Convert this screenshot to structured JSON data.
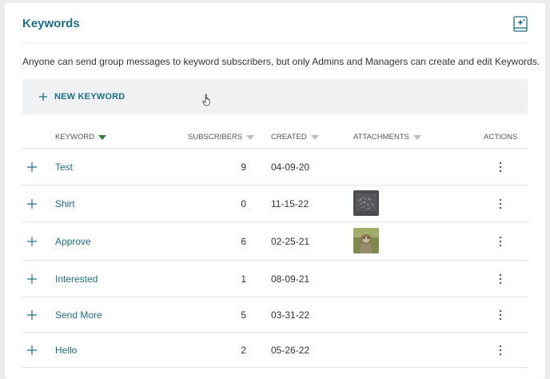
{
  "header": {
    "title": "Keywords",
    "icon": "sparkle-document-icon"
  },
  "description": "Anyone can send group messages to keyword subscribers, but only Admins and Managers can create and edit Keywords.",
  "new_keyword": {
    "label": "NEW KEYWORD",
    "icon": "plus-icon"
  },
  "table": {
    "columns": {
      "keyword": "KEYWORD",
      "subscribers": "SUBSCRIBERS",
      "created": "CREATED",
      "attachments": "ATTACHMENTS",
      "actions": "ACTIONS"
    },
    "sort": {
      "column": "keyword",
      "active_color": "#2e7d32"
    },
    "rows": [
      {
        "keyword": "Test",
        "subscribers": "9",
        "created": "04-09-20",
        "attachment": ""
      },
      {
        "keyword": "Shirt",
        "subscribers": "0",
        "created": "11-15-22",
        "attachment": "dark-image-thumbnail"
      },
      {
        "keyword": "Approve",
        "subscribers": "6",
        "created": "02-25-21",
        "attachment": "photo-thumbnail"
      },
      {
        "keyword": "Interested",
        "subscribers": "1",
        "created": "08-09-21",
        "attachment": ""
      },
      {
        "keyword": "Send More",
        "subscribers": "5",
        "created": "03-31-22",
        "attachment": ""
      },
      {
        "keyword": "Hello",
        "subscribers": "2",
        "created": "05-26-22",
        "attachment": ""
      }
    ]
  },
  "colors": {
    "accent": "#1b6f8a",
    "bar": "#f0f1f2",
    "page": "#ececec"
  }
}
